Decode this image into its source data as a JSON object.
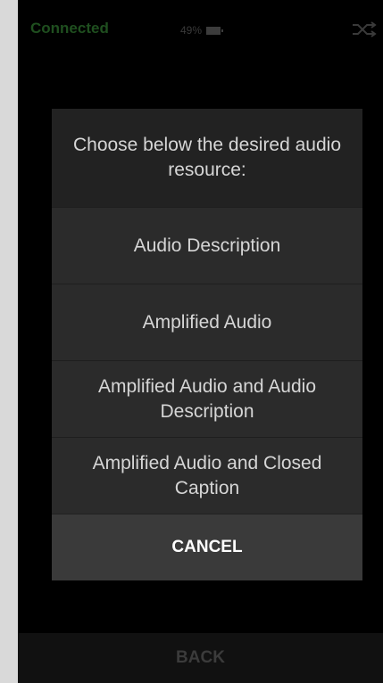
{
  "status_bar": {
    "connection": "Connected",
    "battery_percent": "49%",
    "battery_icon": "battery-icon",
    "shuffle_icon": "shuffle-icon"
  },
  "dialog": {
    "title": "Choose below the desired audio resource:",
    "options": [
      "Audio Description",
      "Amplified Audio",
      "Amplified Audio and Audio Description",
      "Amplified Audio and Closed Caption"
    ],
    "cancel_label": "CANCEL"
  },
  "bottom_bar": {
    "back_label": "BACK"
  },
  "colors": {
    "connected": "#1f4f1f",
    "dialog_background": "#222222",
    "option_background": "#2b2b2b",
    "cancel_background": "#3a3a3a",
    "text": "#d6d6d6"
  }
}
